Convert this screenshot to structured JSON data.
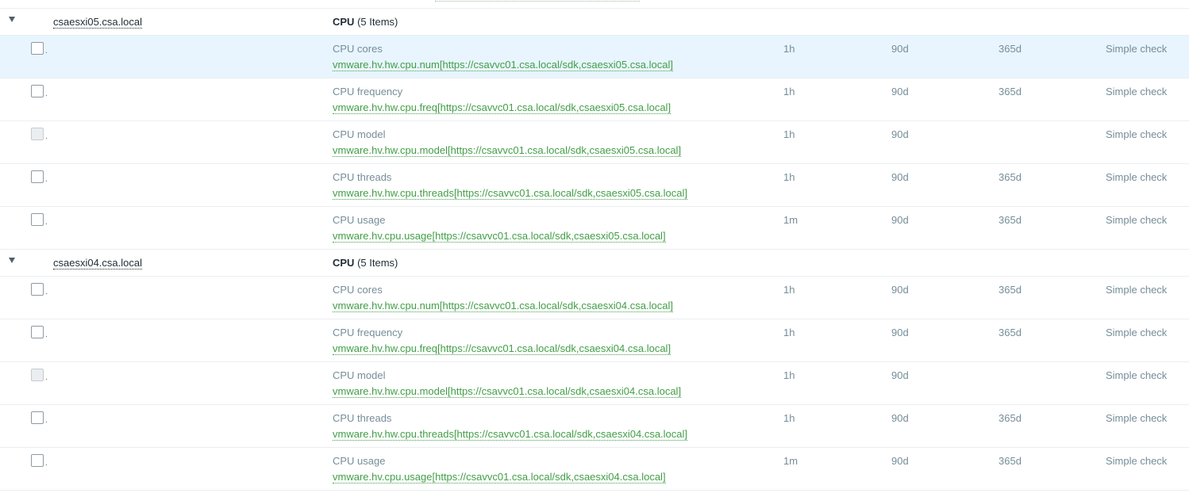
{
  "groups": [
    {
      "host": "csaesxi05.csa.local",
      "application": "CPU",
      "count_label": "(5 Items)",
      "items": [
        {
          "name": "CPU cores",
          "key": "vmware.hv.hw.cpu.num[https://csavvc01.csa.local/sdk,csaesxi05.csa.local]",
          "interval": "1h",
          "history": "90d",
          "trends": "365d",
          "type": "Simple check"
        },
        {
          "name": "CPU frequency",
          "key": "vmware.hv.hw.cpu.freq[https://csavvc01.csa.local/sdk,csaesxi05.csa.local]",
          "interval": "1h",
          "history": "90d",
          "trends": "365d",
          "type": "Simple check"
        },
        {
          "name": "CPU model",
          "key": "vmware.hv.hw.cpu.model[https://csavvc01.csa.local/sdk,csaesxi05.csa.local]",
          "interval": "1h",
          "history": "90d",
          "trends": "",
          "type": "Simple check"
        },
        {
          "name": "CPU threads",
          "key": "vmware.hv.hw.cpu.threads[https://csavvc01.csa.local/sdk,csaesxi05.csa.local]",
          "interval": "1h",
          "history": "90d",
          "trends": "365d",
          "type": "Simple check"
        },
        {
          "name": "CPU usage",
          "key": "vmware.hv.cpu.usage[https://csavvc01.csa.local/sdk,csaesxi05.csa.local]",
          "interval": "1m",
          "history": "90d",
          "trends": "365d",
          "type": "Simple check"
        }
      ]
    },
    {
      "host": "csaesxi04.csa.local",
      "application": "CPU",
      "count_label": "(5 Items)",
      "items": [
        {
          "name": "CPU cores",
          "key": "vmware.hv.hw.cpu.num[https://csavvc01.csa.local/sdk,csaesxi04.csa.local]",
          "interval": "1h",
          "history": "90d",
          "trends": "365d",
          "type": "Simple check"
        },
        {
          "name": "CPU frequency",
          "key": "vmware.hv.hw.cpu.freq[https://csavvc01.csa.local/sdk,csaesxi04.csa.local]",
          "interval": "1h",
          "history": "90d",
          "trends": "365d",
          "type": "Simple check"
        },
        {
          "name": "CPU model",
          "key": "vmware.hv.hw.cpu.model[https://csavvc01.csa.local/sdk,csaesxi04.csa.local]",
          "interval": "1h",
          "history": "90d",
          "trends": "",
          "type": "Simple check"
        },
        {
          "name": "CPU threads",
          "key": "vmware.hv.hw.cpu.threads[https://csavvc01.csa.local/sdk,csaesxi04.csa.local]",
          "interval": "1h",
          "history": "90d",
          "trends": "365d",
          "type": "Simple check"
        },
        {
          "name": "CPU usage",
          "key": "vmware.hv.cpu.usage[https://csavvc01.csa.local/sdk,csaesxi04.csa.local]",
          "interval": "1m",
          "history": "90d",
          "trends": "365d",
          "type": "Simple check"
        }
      ]
    }
  ],
  "selected_row": "0.0",
  "disabled_checkbox_rows": [
    "0.2",
    "1.2"
  ],
  "colors": {
    "key_link": "#429e47",
    "muted_text": "#768d99",
    "selected_row_bg": "#e8f5ff",
    "row_border": "#ebeef0"
  },
  "icons": {
    "group_toggle": "triangle-down-icon"
  }
}
